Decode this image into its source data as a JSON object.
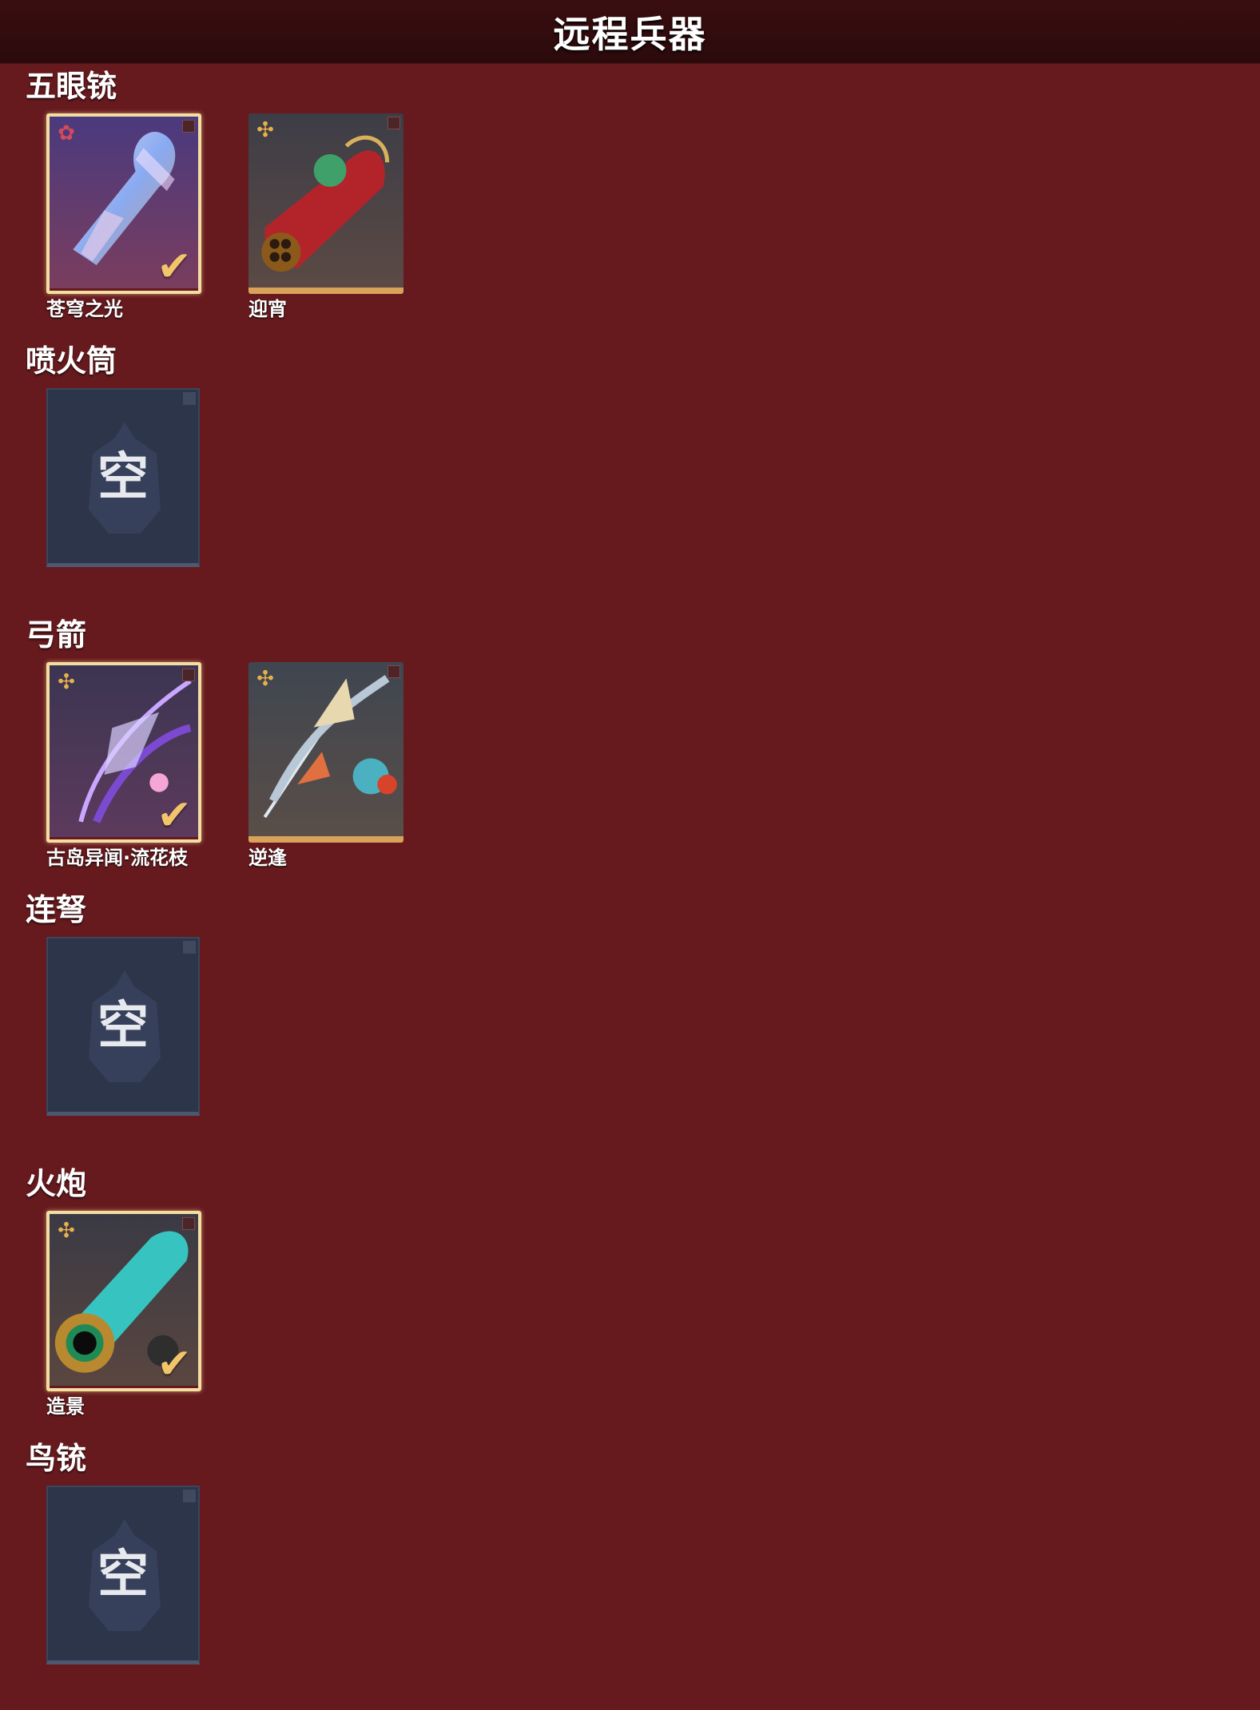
{
  "header": {
    "title": "远程兵器"
  },
  "sections": [
    {
      "name": "五眼铳",
      "items": [
        {
          "label": "苍穹之光",
          "selected": true,
          "rarity_icon": "flower-badge-icon"
        },
        {
          "label": "迎宵",
          "selected": false,
          "rarity_icon": "shuriken-badge-icon"
        }
      ]
    },
    {
      "name": "喷火筒",
      "empty_text": "空"
    },
    {
      "name": "弓箭",
      "items": [
        {
          "label": "古岛异闻·流花枝",
          "selected": true,
          "rarity_icon": "shuriken-badge-icon"
        },
        {
          "label": "逆逢",
          "selected": false,
          "rarity_icon": "shuriken-badge-icon"
        }
      ]
    },
    {
      "name": "连弩",
      "empty_text": "空"
    },
    {
      "name": "火炮",
      "items": [
        {
          "label": "造景",
          "selected": true,
          "rarity_icon": "shuriken-badge-icon"
        }
      ]
    },
    {
      "name": "鸟铳",
      "empty_text": "空"
    }
  ],
  "colors": {
    "background": "#661a1e",
    "header": "#2b0a0c",
    "selected_border": "#f4dda0",
    "card_bottom": "#d9a25a",
    "check": "#f3c56a",
    "empty_slot": "#2c3549"
  }
}
